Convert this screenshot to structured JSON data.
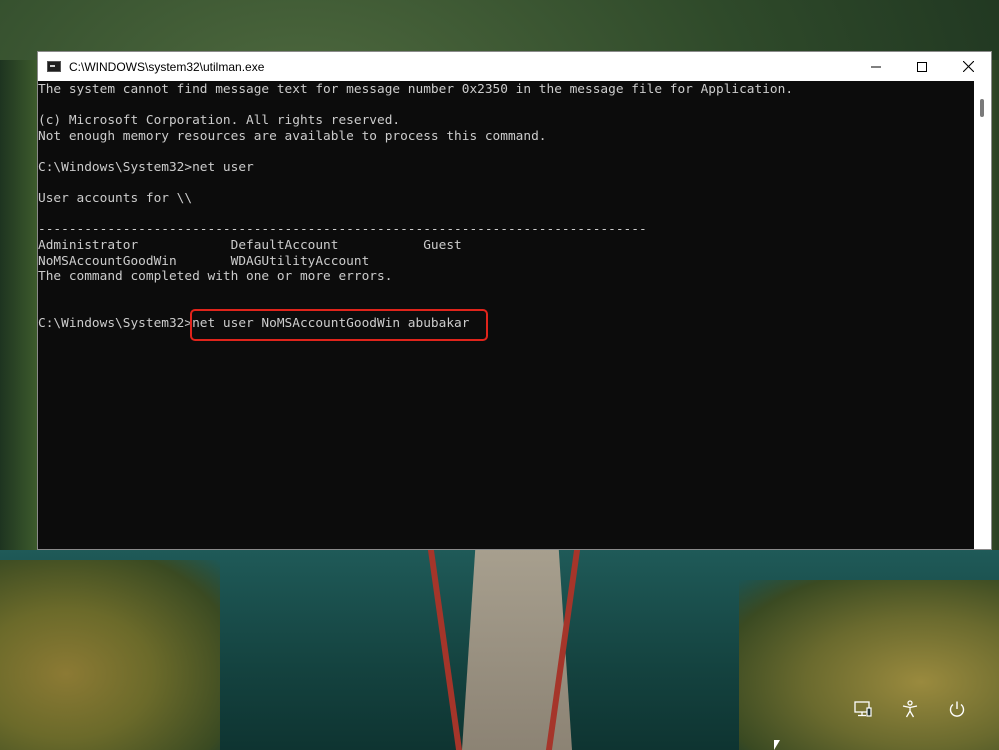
{
  "window": {
    "title": "C:\\WINDOWS\\system32\\utilman.exe"
  },
  "console": {
    "lines": [
      "The system cannot find message text for message number 0x2350 in the message file for Application.",
      "",
      "(c) Microsoft Corporation. All rights reserved.",
      "Not enough memory resources are available to process this command.",
      "",
      "C:\\Windows\\System32>net user",
      "",
      "User accounts for \\\\",
      "",
      "-------------------------------------------------------------------------------",
      "Administrator            DefaultAccount           Guest",
      "NoMSAccountGoodWin       WDAGUtilityAccount",
      "The command completed with one or more errors.",
      "",
      "",
      "C:\\Windows\\System32>net user NoMSAccountGoodWin abubakar"
    ]
  },
  "accent": {
    "highlight": "#e0241b",
    "console_bg": "#0c0c0c",
    "console_text": "#cccccc"
  },
  "taskbar_icons": [
    "network-icon",
    "accessibility-icon",
    "power-icon"
  ]
}
